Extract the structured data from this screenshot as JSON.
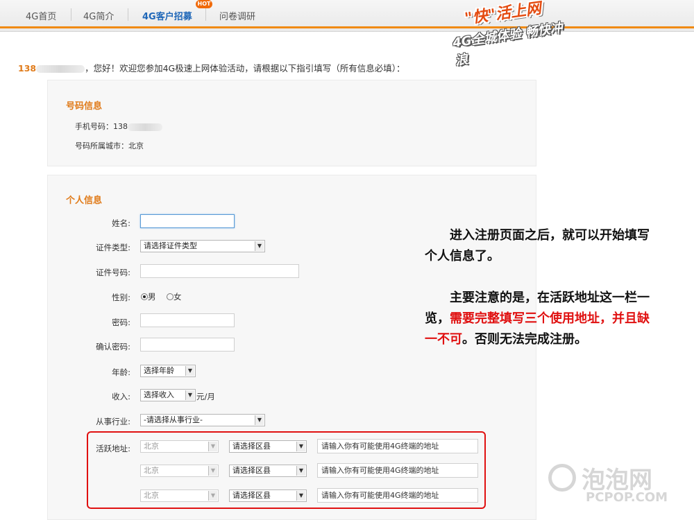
{
  "nav": {
    "items": [
      "4G首页",
      "4G简介",
      "4G客户招募",
      "问卷调研"
    ],
    "hot_badge": "HOT"
  },
  "banner": {
    "line1": "\"快\"活上网",
    "line2": "4G全城体验 畅快冲浪"
  },
  "greeting": {
    "number_prefix": "138",
    "text": "，您好！欢迎您参加4G极速上网体验活动，请根据以下指引填写（所有信息必填）："
  },
  "number_info": {
    "title": "号码信息",
    "phone_label": "手机号码：138",
    "city_label": "号码所属城市：北京"
  },
  "personal_info": {
    "title": "个人信息",
    "name_label": "姓名:",
    "id_type_label": "证件类型:",
    "id_type_value": "请选择证件类型",
    "id_number_label": "证件号码:",
    "gender_label": "性别:",
    "gender_male": "男",
    "gender_female": "女",
    "password_label": "密码:",
    "confirm_password_label": "确认密码:",
    "age_label": "年龄:",
    "age_value": "选择年龄",
    "income_label": "收入:",
    "income_value": "选择收入",
    "income_unit": "元/月",
    "industry_label": "从事行业:",
    "industry_value": "-请选择从事行业-",
    "address_label": "活跃地址:",
    "address_rows": [
      {
        "city": "北京",
        "district": "请选择区县",
        "placeholder": "请输入你有可能使用4G终端的地址"
      },
      {
        "city": "北京",
        "district": "请选择区县",
        "placeholder": "请输入你有可能使用4G终端的地址"
      },
      {
        "city": "北京",
        "district": "请选择区县",
        "placeholder": "请输入你有可能使用4G终端的地址"
      }
    ]
  },
  "annotation": {
    "para1": "进入注册页面之后，就可以开始填写个人信息了。",
    "para2_a": "主要注意的是，在活跃地址这一栏一览，",
    "para2_red": "需要完整填写三个使用地址，并且缺一不可",
    "para2_b": "。否则无法完成注册。"
  },
  "watermark": {
    "cn": "泡泡网",
    "en": "PCPOP.COM"
  },
  "colors": {
    "accent_orange": "#e07b1a",
    "nav_active": "#1f67b8",
    "highlight_red": "#e01010"
  }
}
